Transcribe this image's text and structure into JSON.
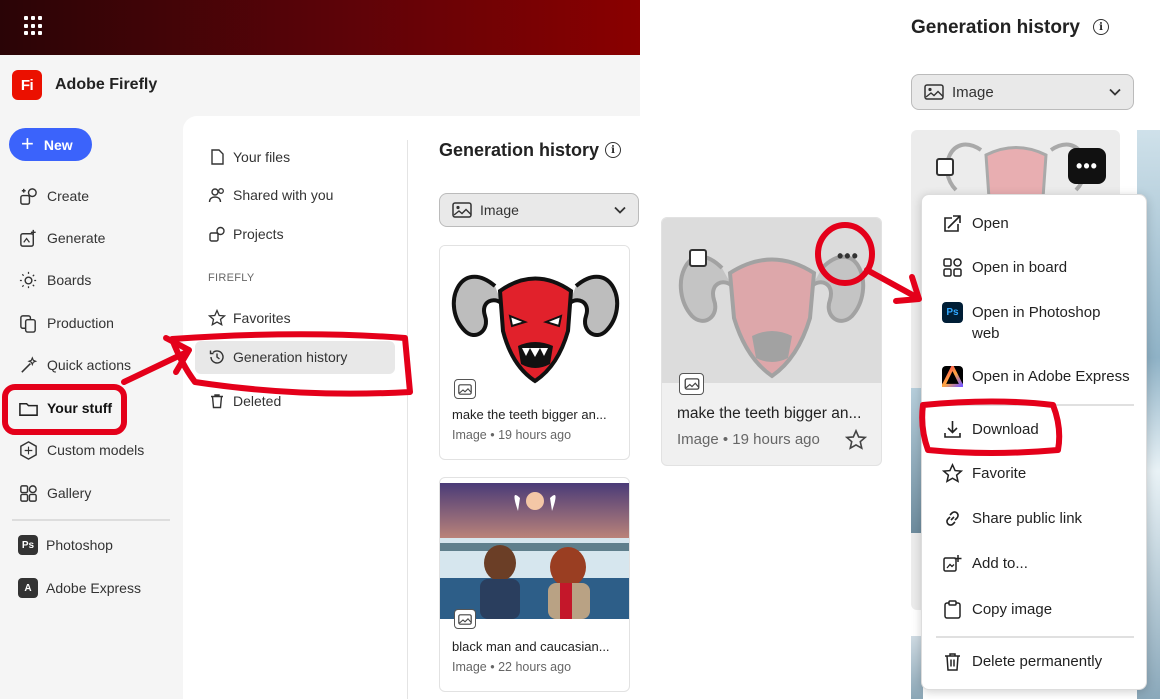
{
  "app": {
    "name": "Adobe Firefly",
    "logo_text": "Fi"
  },
  "new_button": {
    "label": "New"
  },
  "nav": {
    "create": "Create",
    "generate": "Generate",
    "boards": "Boards",
    "production": "Production",
    "quick_actions": "Quick actions",
    "your_stuff": "Your stuff",
    "custom_models": "Custom models",
    "gallery": "Gallery",
    "photoshop": "Photoshop",
    "adobe_express": "Adobe Express",
    "ps_badge": "Ps",
    "ae_badge": "A"
  },
  "subnav": {
    "your_files": "Your files",
    "shared": "Shared with you",
    "projects": "Projects",
    "section": "FIREFLY",
    "favorites": "Favorites",
    "generation_history": "Generation history",
    "deleted": "Deleted"
  },
  "history": {
    "title": "Generation history",
    "info": "i",
    "filter": "Image",
    "cards": [
      {
        "title": "make the teeth bigger an...",
        "meta": "Image • 19 hours ago"
      },
      {
        "title": "black man and caucasian...",
        "meta": "Image • 22 hours ago"
      }
    ]
  },
  "zoom_card": {
    "title": "make the teeth bigger an...",
    "meta": "Image • 19 hours ago"
  },
  "right": {
    "title": "Generation history",
    "info": "i",
    "filter": "Image",
    "more": "•••"
  },
  "menu": {
    "open": "Open",
    "open_board": "Open in board",
    "open_ps": "Open in Photoshop web",
    "open_ae": "Open in Adobe Express",
    "download": "Download",
    "favorite": "Favorite",
    "share": "Share public link",
    "add_to": "Add to...",
    "copy": "Copy image",
    "delete": "Delete permanently",
    "ps_badge": "Ps"
  },
  "colors": {
    "brand_red": "#eb1000",
    "accent_blue": "#3b63fb",
    "annotation_red": "#e4001a"
  }
}
